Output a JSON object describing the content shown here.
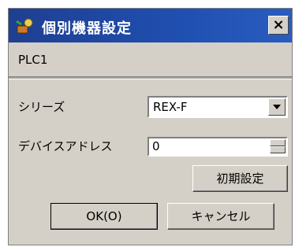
{
  "window": {
    "title": "個別機器設定",
    "close_label": "×"
  },
  "device": {
    "name": "PLC1"
  },
  "form": {
    "series_label": "シリーズ",
    "series_value": "REX-F",
    "address_label": "デバイスアドレス",
    "address_value": "0"
  },
  "buttons": {
    "init_label": "初期設定",
    "ok_label": "OK(O)",
    "cancel_label": "キャンセル"
  },
  "icons": {
    "title": "device-settings-icon",
    "dropdown": "chevron-down-icon",
    "spin": "spinner-icon"
  }
}
